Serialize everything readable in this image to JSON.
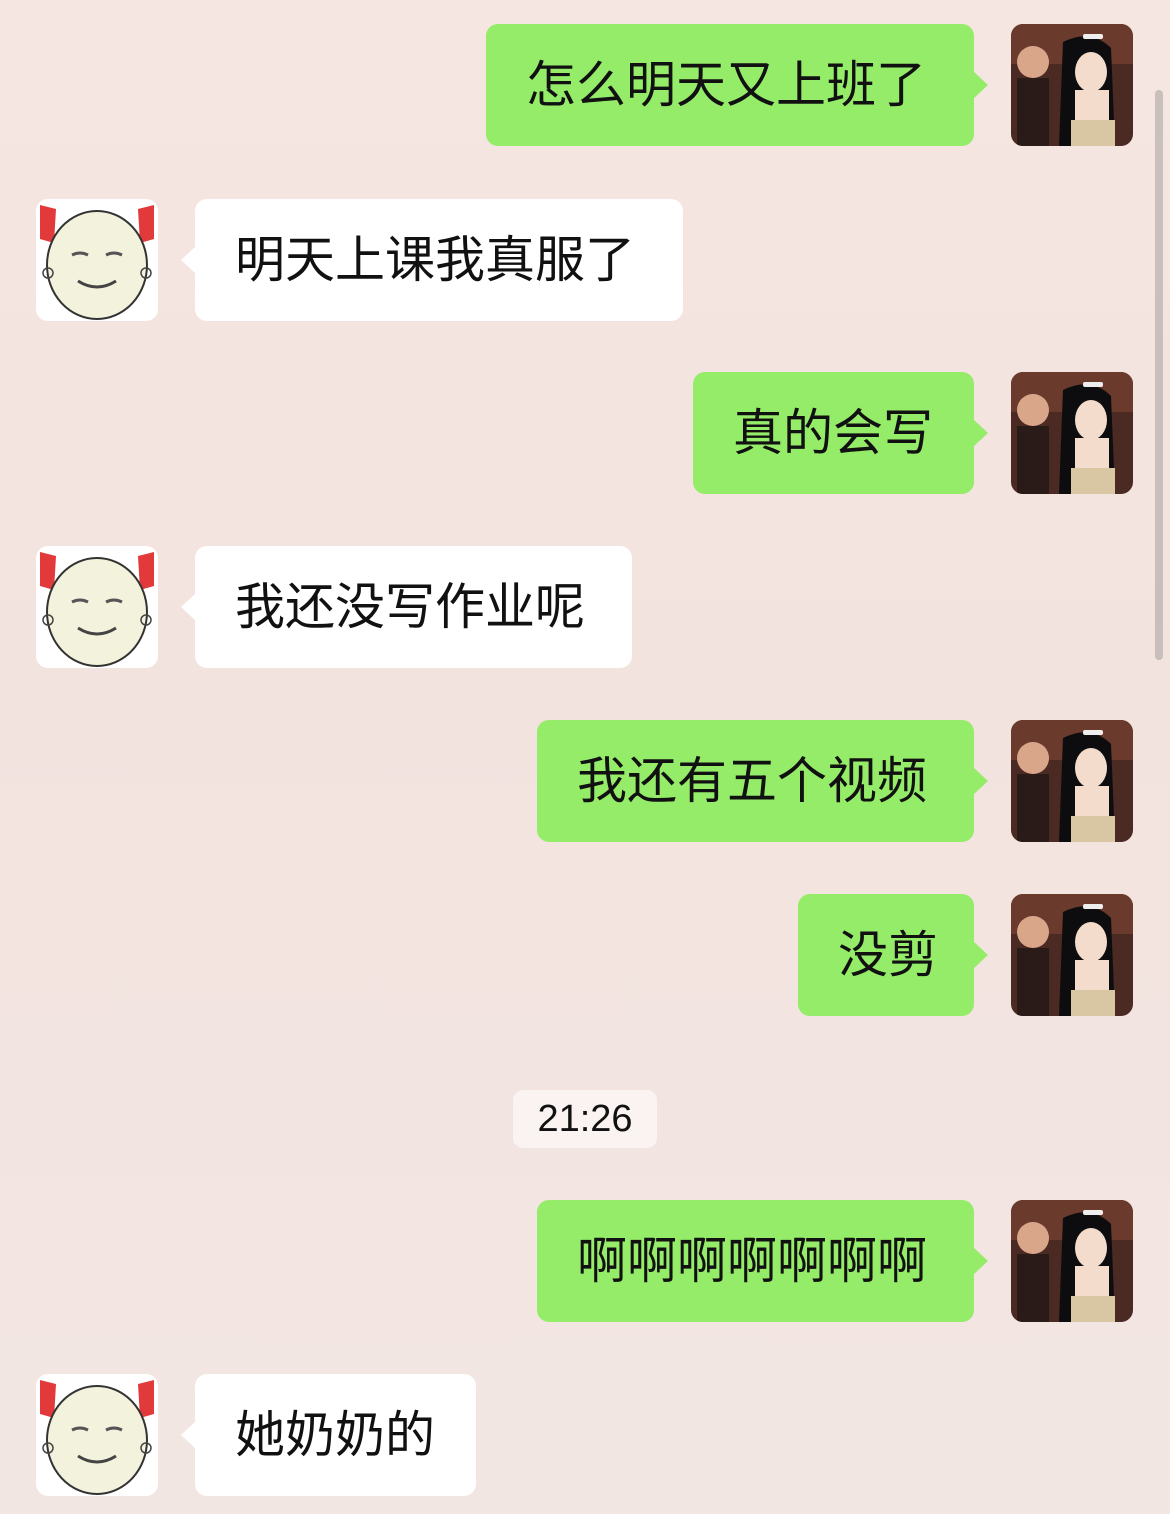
{
  "chat": {
    "messages": [
      {
        "dir": "out",
        "text": "怎么明天又上班了",
        "avatar": "girl-avatar"
      },
      {
        "dir": "in",
        "text": "明天上课我真服了",
        "avatar": "egg-face-avatar"
      },
      {
        "dir": "out",
        "text": "真的会写",
        "avatar": "girl-avatar"
      },
      {
        "dir": "in",
        "text": "我还没写作业呢",
        "avatar": "egg-face-avatar"
      },
      {
        "dir": "out",
        "text": "我还有五个视频",
        "avatar": "girl-avatar"
      },
      {
        "dir": "out",
        "text": "没剪",
        "avatar": "girl-avatar"
      },
      {
        "dir": "out",
        "text": "啊啊啊啊啊啊啊",
        "avatar": "girl-avatar"
      },
      {
        "dir": "in",
        "text": "她奶奶的",
        "avatar": "egg-face-avatar"
      }
    ],
    "timestamp": "21:26"
  },
  "colors": {
    "outgoing_bubble": "#95ec69",
    "incoming_bubble": "#ffffff",
    "text": "#111111"
  }
}
